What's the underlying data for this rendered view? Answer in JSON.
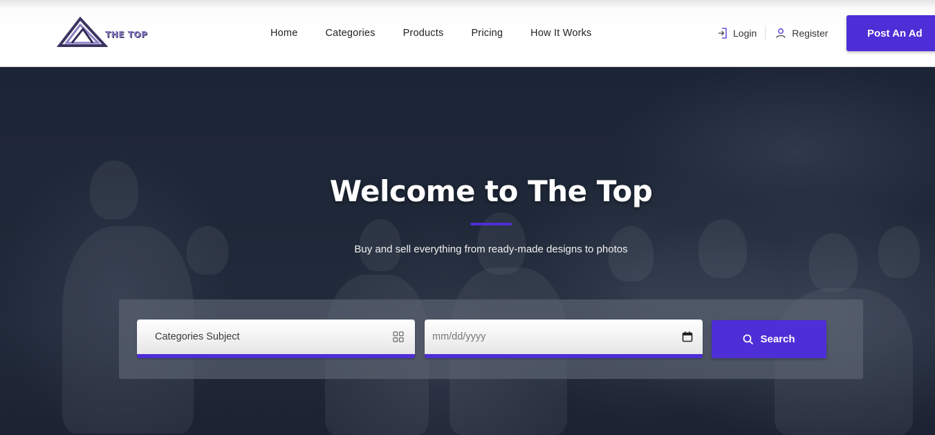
{
  "brand": {
    "name": "THE TOP",
    "accent_color": "#4e2ed6"
  },
  "nav": {
    "items": [
      {
        "label": "Home"
      },
      {
        "label": "Categories"
      },
      {
        "label": "Products"
      },
      {
        "label": "Pricing"
      },
      {
        "label": "How It Works"
      }
    ]
  },
  "auth": {
    "login_label": "Login",
    "login_icon": "login-arrow-icon",
    "register_label": "Register",
    "register_icon": "user-icon"
  },
  "header": {
    "post_ad_label": "Post An Ad"
  },
  "hero": {
    "title": "Welcome to The Top",
    "subtitle": "Buy and sell everything from ready-made designs to photos"
  },
  "search": {
    "category_placeholder": "Categories Subject",
    "category_icon": "grid-icon",
    "date_placeholder": "mm/dd/yyyy",
    "date_icon": "calendar-icon",
    "button_label": "Search",
    "button_icon": "search-icon"
  }
}
